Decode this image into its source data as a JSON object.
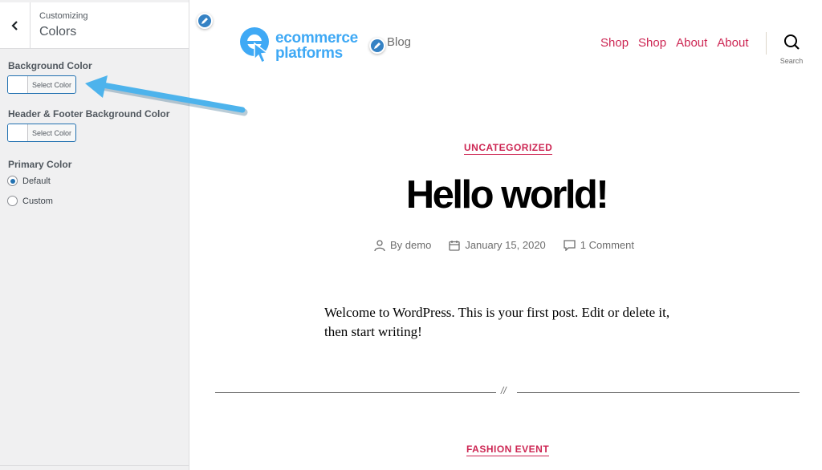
{
  "sidebar": {
    "header_small": "Customizing",
    "header_title": "Colors",
    "controls": [
      {
        "label": "Background Color",
        "button_label": "Select Color",
        "swatch": "#ffffff"
      },
      {
        "label": "Header & Footer Background Color",
        "button_label": "Select Color",
        "swatch": "#ffffff"
      }
    ],
    "primary_color": {
      "label": "Primary Color",
      "options": [
        {
          "label": "Default",
          "checked": true
        },
        {
          "label": "Custom",
          "checked": false
        }
      ]
    }
  },
  "site": {
    "logo_line1": "ecommerce",
    "logo_line2": "platforms",
    "blog_label": "Blog",
    "nav": [
      "Shop",
      "Shop",
      "About",
      "About"
    ],
    "search_label": "Search"
  },
  "post": {
    "category": "UNCATEGORIZED",
    "title": "Hello world!",
    "author": "By demo",
    "date": "January 15, 2020",
    "comments": "1 Comment",
    "body": "Welcome to WordPress. This is your first post. Edit or delete it, then start writing!",
    "divider_mark": "//",
    "next_category": "FASHION EVENT"
  },
  "colors": {
    "accent": "#cd2653",
    "wp_blue": "#2271b1",
    "logo_blue": "#3fa9f5",
    "annotation_arrow": "#4db3ec"
  }
}
